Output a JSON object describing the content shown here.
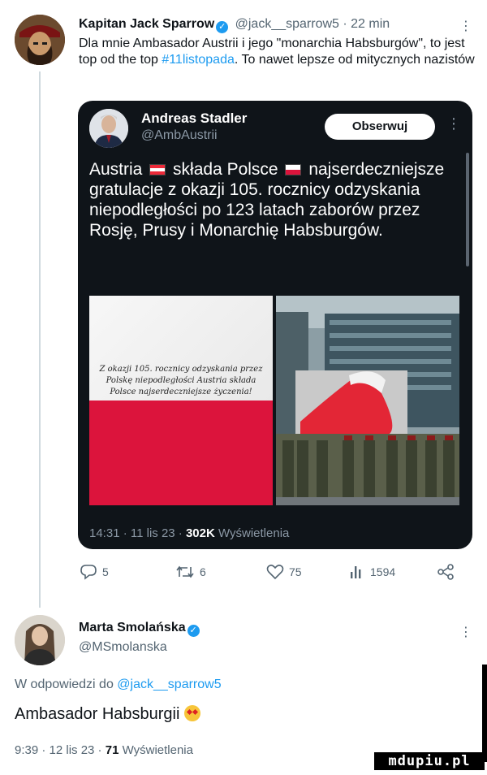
{
  "tweet": {
    "author_name": "Kapitan Jack Sparrow",
    "handle": "@jack__sparrow5",
    "time": "· 22 min",
    "more": "⋮",
    "text_before": "Dla mnie Ambasador Austrii i jego \"monarchia Habsburgów\", to jest top od the top ",
    "hashtag": "#11listopada",
    "text_after": ". To nawet lepsze od mitycznych nazistów"
  },
  "quoted": {
    "author_name": "Andreas Stadler",
    "handle": "@AmbAustrii",
    "follow_label": "Obserwuj",
    "more": "⋮",
    "text_part1": "Austria",
    "text_part2": "składa Polsce",
    "text_part3": "najserdeczniejsze gratulacje z okazji 105. rocznicy odzyskania niepodległości po 123 latach zaborów przez Rosję, Prusy i Monarchię Habsburgów.",
    "image_left_text": "Z okazji 105. rocznicy odzyskania przez Polskę niepodległości Austria składa Polsce najserdeczniejsze życzenia!",
    "stats_time": "14:31 · 11 lis 23 · ",
    "views_count": "302K",
    "views_label": " Wyświetlenia"
  },
  "actions": {
    "replies": "5",
    "retweets": "6",
    "likes": "75",
    "views": "1594"
  },
  "reply": {
    "author_name": "Marta Smolańska",
    "handle": "@MSmolanska",
    "more": "⋮",
    "reply_prefix": "W odpowiedzi do ",
    "reply_to": "@jack__sparrow5",
    "text": "Ambasador Habsburgii",
    "meta_time": "9:39 · 12 lis 23 · ",
    "views_count": "71",
    "views_label": " Wyświetlenia"
  },
  "watermark": "mdupiu.pl",
  "colors": {
    "accent": "#1d9bf0",
    "muted": "#536471",
    "card_bg": "#0f1419"
  }
}
